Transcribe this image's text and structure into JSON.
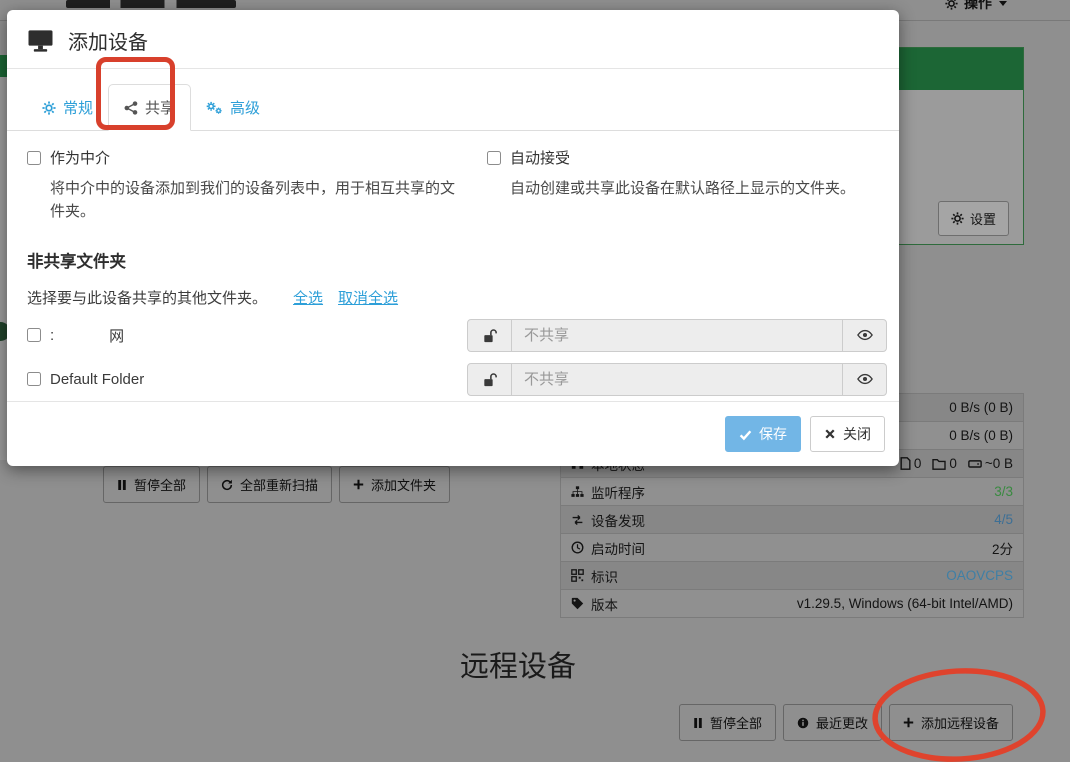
{
  "colors": {
    "accent_blue": "#2d9fd8",
    "save_blue": "#72b6e6",
    "annotation_red": "#d8402c",
    "panel_green_dimmed": "#1c6635",
    "success_green": "#398a40",
    "info_blue": "#3d6f95",
    "id_blue": "#3f7fa5"
  },
  "navbar": {
    "actions_label": "操作"
  },
  "background": {
    "this_device_panel": {
      "settings_label": "设置"
    },
    "device_table": {
      "rows": [
        {
          "label": "",
          "value": "0 B/s (0 B)"
        },
        {
          "label": "",
          "value": "0 B/s (0 B)"
        },
        {
          "label": "本地状态",
          "files": "0",
          "folders": "0",
          "size": "~0 B"
        },
        {
          "label": "监听程序",
          "value": "3/3"
        },
        {
          "label": "设备发现",
          "value": "4/5"
        },
        {
          "label": "启动时间",
          "value": "2分"
        },
        {
          "label": "标识",
          "value": "OAOVCPS"
        },
        {
          "label": "版本",
          "value": "v1.29.5, Windows (64-bit Intel/AMD)"
        }
      ]
    },
    "folder_actions": {
      "pause_all": "暂停全部",
      "rescan_all": "全部重新扫描",
      "add_folder": "添加文件夹"
    },
    "remote_devices": {
      "heading": "远程设备",
      "pause_all": "暂停全部",
      "recent_changes": "最近更改",
      "add_remote_device": "添加远程设备"
    }
  },
  "modal": {
    "title": "添加设备",
    "tabs": {
      "general": "常规",
      "sharing": "共享",
      "advanced": "高级"
    },
    "introducer": {
      "label": "作为中介",
      "help": "将中介中的设备添加到我们的设备列表中，用于相互共享的文件夹。"
    },
    "auto_accept": {
      "label": "自动接受",
      "help": "自动创建或共享此设备在默认路径上显示的文件夹。"
    },
    "unshared_folders": {
      "heading": "非共享文件夹",
      "description": "选择要与此设备共享的其他文件夹。",
      "select_all": "全选",
      "deselect_all": "取消全选",
      "folders": [
        {
          "label_prefix": ":",
          "label": "网",
          "encryption_placeholder": "不共享"
        },
        {
          "label_prefix": "",
          "label": "Default Folder",
          "encryption_placeholder": "不共享"
        }
      ]
    },
    "footer": {
      "save": "保存",
      "close": "关闭"
    }
  }
}
